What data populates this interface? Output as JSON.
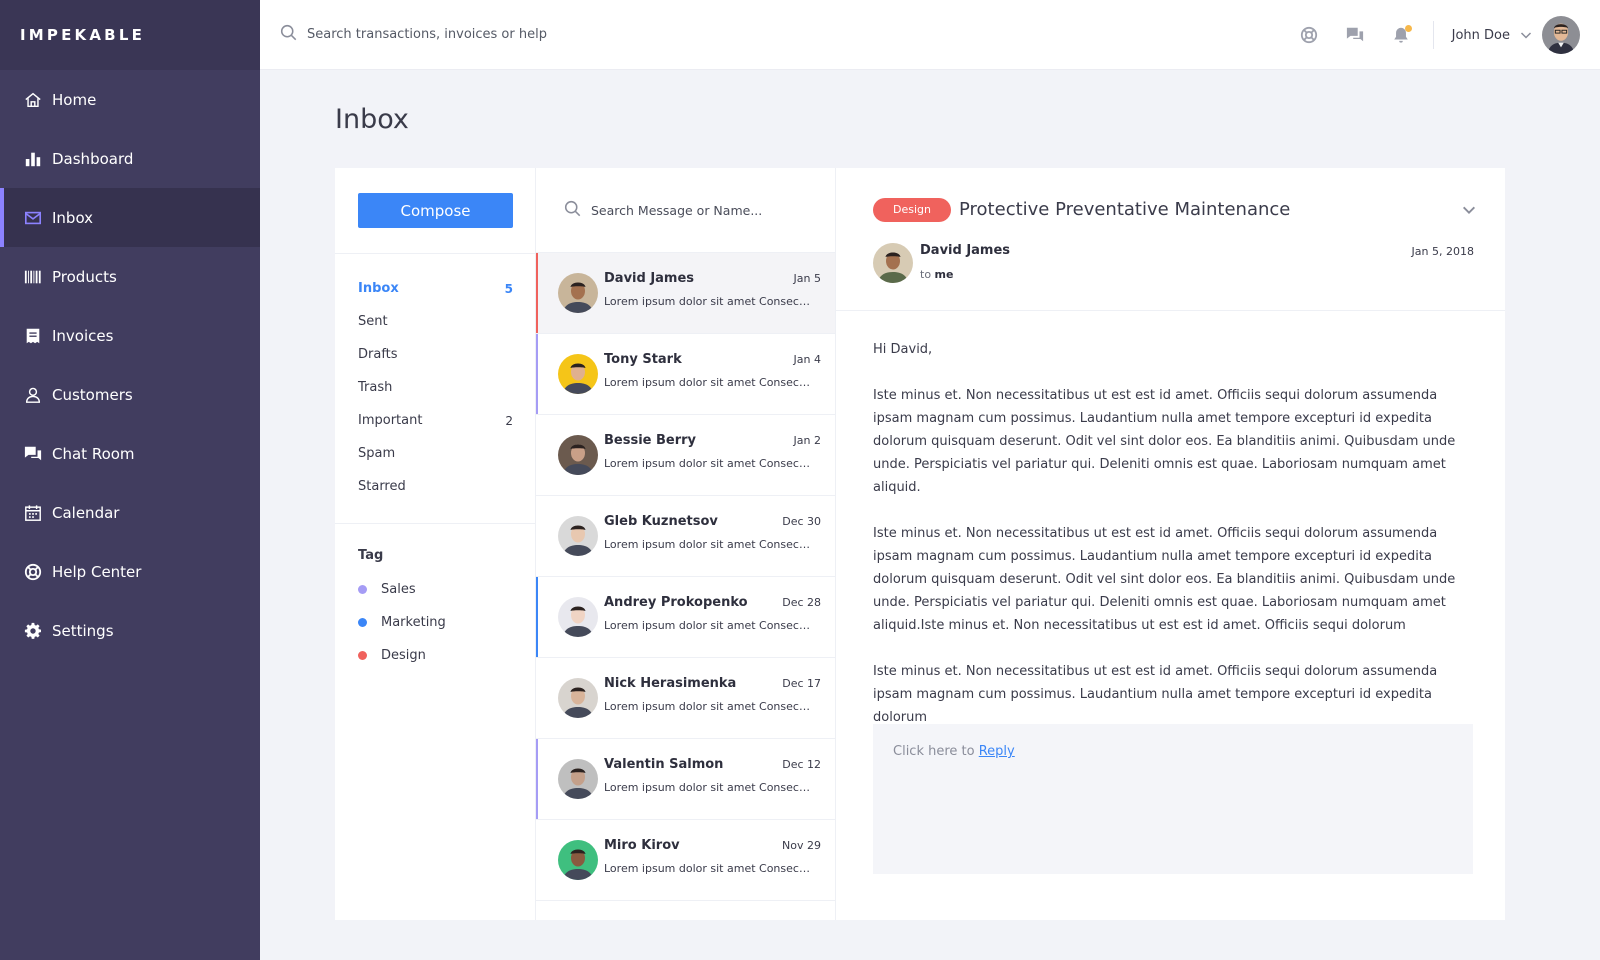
{
  "app": {
    "brand": "IMPEKABLE"
  },
  "sidebar": {
    "items": [
      {
        "label": "Home",
        "icon": "home-icon"
      },
      {
        "label": "Dashboard",
        "icon": "bar-chart-icon"
      },
      {
        "label": "Inbox",
        "icon": "mail-icon",
        "active": true
      },
      {
        "label": "Products",
        "icon": "barcode-icon"
      },
      {
        "label": "Invoices",
        "icon": "invoice-icon"
      },
      {
        "label": "Customers",
        "icon": "user-icon"
      },
      {
        "label": "Chat Room",
        "icon": "chat-icon"
      },
      {
        "label": "Calendar",
        "icon": "calendar-icon"
      },
      {
        "label": "Help Center",
        "icon": "lifebuoy-icon"
      },
      {
        "label": "Settings",
        "icon": "gear-icon"
      }
    ],
    "active_color": "#8c82ff"
  },
  "topbar": {
    "search_placeholder": "Search transactions, invoices or help",
    "user_name": "John Doe",
    "notification_dot_color": "#f7b84b"
  },
  "page": {
    "title": "Inbox"
  },
  "folders": {
    "compose_label": "Compose",
    "items": [
      {
        "label": "Inbox",
        "count": "5",
        "active": true
      },
      {
        "label": "Sent",
        "count": ""
      },
      {
        "label": "Drafts",
        "count": ""
      },
      {
        "label": "Trash",
        "count": ""
      },
      {
        "label": "Important",
        "count": "2"
      },
      {
        "label": "Spam",
        "count": ""
      },
      {
        "label": "Starred",
        "count": ""
      }
    ],
    "tag_title": "Tag",
    "tags": [
      {
        "label": "Sales",
        "color": "#a59cf5"
      },
      {
        "label": "Marketing",
        "color": "#3b86f7"
      },
      {
        "label": "Design",
        "color": "#f0625d"
      }
    ]
  },
  "messages": {
    "search_placeholder": "Search Message or Name...",
    "items": [
      {
        "name": "David James",
        "date": "Jan 5",
        "snippet": "Lorem ipsum dolor sit amet Consectetur...",
        "bar_color": "#f0625d",
        "avatar_bg": "#c8b59a",
        "selected": true
      },
      {
        "name": "Tony Stark",
        "date": "Jan 4",
        "snippet": "Lorem ipsum dolor sit amet Consectetur...",
        "bar_color": "#a59cf5",
        "avatar_bg": "#f5c518"
      },
      {
        "name": "Bessie Berry",
        "date": "Jan 2",
        "snippet": "Lorem ipsum dolor sit amet Consectetur...",
        "bar_color": "",
        "avatar_bg": "#6b5a4e"
      },
      {
        "name": "Gleb Kuznetsov",
        "date": "Dec 30",
        "snippet": "Lorem ipsum dolor sit amet Consectetur...",
        "bar_color": "",
        "avatar_bg": "#d9d9d9"
      },
      {
        "name": "Andrey Prokopenko",
        "date": "Dec 28",
        "snippet": "Lorem ipsum dolor sit amet Consectetur...",
        "bar_color": "#3b86f7",
        "avatar_bg": "#e8e8ee"
      },
      {
        "name": "Nick Herasimenka",
        "date": "Dec 17",
        "snippet": "Lorem ipsum dolor sit amet Consectetur...",
        "bar_color": "",
        "avatar_bg": "#d8d4cf"
      },
      {
        "name": "Valentin Salmon",
        "date": "Dec 12",
        "snippet": "Lorem ipsum dolor sit amet Consectetur...",
        "bar_color": "#a59cf5",
        "avatar_bg": "#bfbfbf"
      },
      {
        "name": "Miro Kirov",
        "date": "Nov 29",
        "snippet": "Lorem ipsum dolor sit amet Consectetur...",
        "bar_color": "",
        "avatar_bg": "#3fbf7f"
      }
    ]
  },
  "reader": {
    "tag": "Design",
    "tag_color": "#f0625d",
    "subject": "Protective Preventative Maintenance",
    "sender_name": "David James",
    "to_prefix": "to",
    "to_name": "me",
    "date": "Jan 5, 2018",
    "greeting": "Hi David,",
    "paragraphs": [
      "Iste minus et. Non necessitatibus ut est est id amet. Officiis sequi dolorum assumenda ipsam magnam cum possimus. Laudantium nulla amet tempore excepturi id expedita dolorum quisquam deserunt. Odit vel sint dolor eos. Ea blanditiis animi. Quibusdam unde unde. Perspiciatis vel pariatur qui. Deleniti omnis est quae. Laboriosam numquam amet aliquid.",
      "Iste minus et. Non necessitatibus ut est est id amet. Officiis sequi dolorum assumenda ipsam magnam cum possimus. Laudantium nulla amet tempore excepturi id expedita dolorum quisquam deserunt. Odit vel sint dolor eos. Ea blanditiis animi. Quibusdam unde unde. Perspiciatis vel pariatur qui. Deleniti omnis est quae. Laboriosam numquam amet aliquid.Iste minus et. Non necessitatibus ut est est id amet. Officiis sequi dolorum",
      "Iste minus et. Non necessitatibus ut est est id amet. Officiis sequi dolorum assumenda ipsam magnam cum possimus. Laudantium nulla amet tempore excepturi id expedita dolorum"
    ],
    "reply_prefix": "Click here to",
    "reply_link": "Reply"
  }
}
